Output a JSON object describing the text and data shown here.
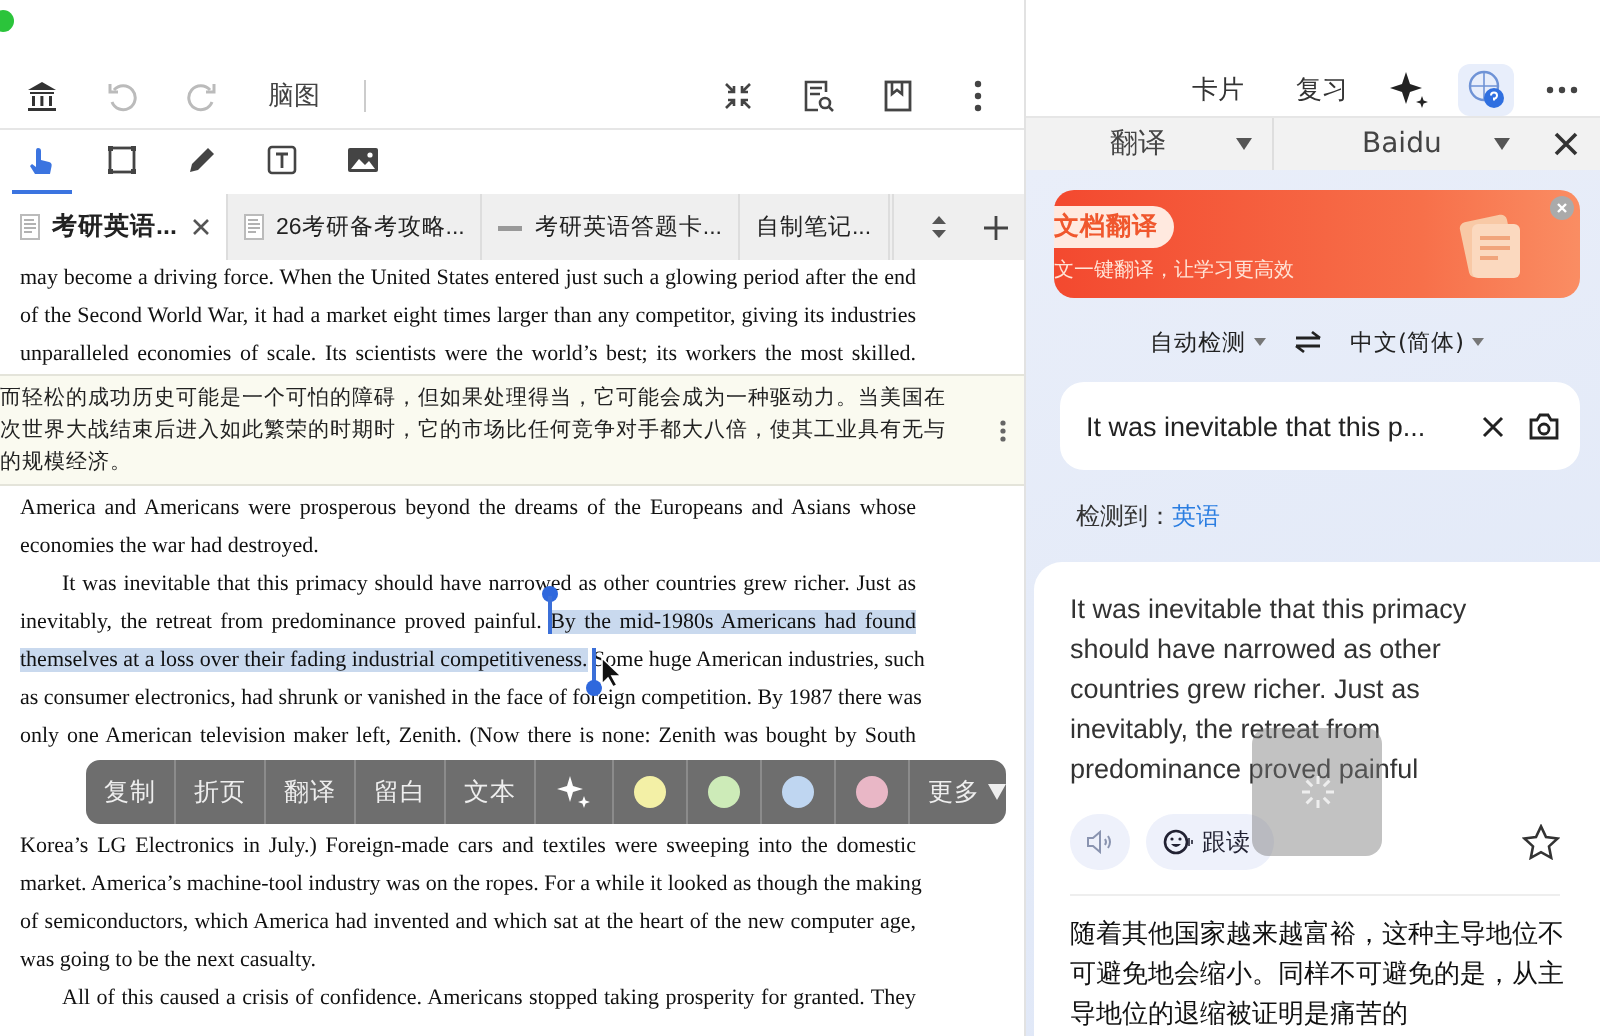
{
  "toolbar": {
    "mind_map_label": "脑图"
  },
  "tools": [
    {
      "kind": "pointer",
      "selected": true
    },
    {
      "kind": "rectangle",
      "selected": false
    },
    {
      "kind": "pen",
      "selected": false
    },
    {
      "kind": "text",
      "selected": false
    },
    {
      "kind": "image",
      "selected": false
    }
  ],
  "tabs": [
    {
      "label": "考研英语...",
      "kind": "document",
      "selected": true
    },
    {
      "label": "26考研备考攻略...",
      "kind": "document",
      "selected": false
    },
    {
      "label": "考研英语答题卡...",
      "kind": "sheet",
      "selected": false
    },
    {
      "label": "自制笔记...",
      "kind": "none",
      "selected": false
    }
  ],
  "document": {
    "blocks": [
      {
        "kind": "paragraph",
        "indent": false,
        "ends": false,
        "lines": [
          [
            {
              "text": "may become a driving force. When the United States entered just such a glowing period after the end",
              "selected": false
            }
          ],
          [
            {
              "text": "of the Second World War, it had a market eight times larger than any competitor, giving its industries",
              "selected": false
            }
          ],
          [
            {
              "text": "unparalleled economies of scale. Its scientists were the world’s best; its workers the most skilled.",
              "selected": false
            }
          ]
        ]
      },
      {
        "kind": "translation",
        "lines": [
          "而轻松的成功历史可能是一个可怕的障碍，但如果处理得当，它可能会成为一种驱动力。当美国在",
          "次世界大战结束后进入如此繁荣的时期时，它的市场比任何竞争对手都大八倍，使其工业具有无与",
          "的规模经济。"
        ]
      },
      {
        "kind": "paragraph",
        "indent": false,
        "ends": true,
        "lines": [
          [
            {
              "text": "America and Americans were prosperous beyond the dreams of the Europeans and Asians whose",
              "selected": false
            }
          ],
          [
            {
              "text": "economies the war had destroyed.",
              "selected": false
            }
          ]
        ]
      },
      {
        "kind": "paragraph",
        "indent": true,
        "ends": true,
        "lines": [
          [
            {
              "text": "It was inevitable that this primacy should have narrowed as other countries grew richer. Just as",
              "selected": false
            }
          ],
          [
            {
              "text": "inevitably, the retreat from predominance proved painful.",
              "selected": false
            },
            {
              "text": "By the mid-1980s Americans had found",
              "selected": true
            }
          ],
          [
            {
              "text": "themselves at a loss over their fading industrial competitiveness.",
              "selected": true
            },
            {
              "text": "Some huge American industries, such",
              "selected": false
            }
          ],
          [
            {
              "text": "as consumer electronics, had shrunk or vanished in the face of foreign competition. By 1987 there was",
              "selected": false
            }
          ],
          [
            {
              "text": "only one American television maker left, Zenith. (Now there is none: Zenith was bought by South",
              "selected": false
            }
          ],
          [
            {
              "text": "Korea’s LG Electronics in July.) Foreign-made cars and textiles were sweeping into the domestic",
              "selected": false
            }
          ],
          [
            {
              "text": "market. America’s machine-tool industry was on the ropes. For a while it looked as though the making",
              "selected": false
            }
          ],
          [
            {
              "text": "of semiconductors, which America had invented and which sat at the heart of the new computer age,",
              "selected": false
            }
          ],
          [
            {
              "text": "was going to be the next casualty.",
              "selected": false
            }
          ]
        ]
      },
      {
        "kind": "paragraph",
        "indent": true,
        "ends": false,
        "lines": [
          [
            {
              "text": "All of this caused a crisis of confidence. Americans stopped taking prosperity for granted. They",
              "selected": false
            }
          ]
        ]
      }
    ]
  },
  "selection_toolbar": {
    "actions": [
      "复制",
      "折页",
      "翻译",
      "留白",
      "文本"
    ],
    "colors": [
      {
        "color": "#f3f0a6"
      },
      {
        "color": "#cdebb8"
      },
      {
        "color": "#bfd6f1"
      },
      {
        "color": "#e9b7c6"
      }
    ],
    "more_label": "更多"
  },
  "header": {
    "buttons": [
      "卡片",
      "复习"
    ]
  },
  "translator": {
    "mode": "翻译",
    "engine": "Baidu",
    "banner": {
      "title": "文档翻译",
      "subtitle": "文一键翻译，让学习更高效"
    },
    "source_lang": "自动检测",
    "target_lang": "中文(简体)",
    "input": "It was inevitable that this p...",
    "detected_label": "检测到：",
    "detected_lang": "英语",
    "source_text": "It was inevitable that this primacy should have narrowed as other countries grew richer. Just as inevitably, the retreat from predominance proved painful",
    "follow_read": "跟读",
    "translation": "随着其他国家越来越富裕，这种主导地位不可避免地会缩小。同样不可避免的是，从主导地位的退缩被证明是痛苦的"
  }
}
